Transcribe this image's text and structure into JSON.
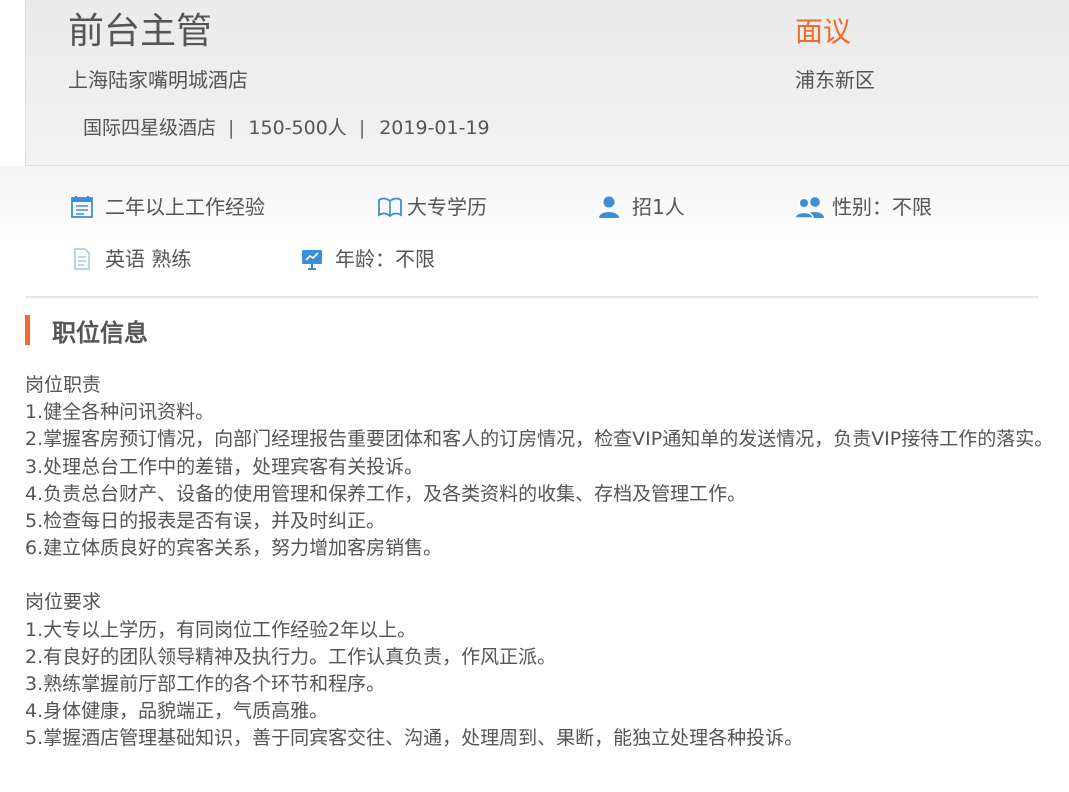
{
  "job": {
    "title": "前台主管",
    "salary": "面议",
    "company": "上海陆家嘴明城酒店",
    "district": "浦东新区",
    "meta": [
      "国际四星级酒店",
      "150-500人",
      "2019-01-19"
    ],
    "separator": "|"
  },
  "requirements": [
    {
      "icon": "calendar-icon",
      "label": "二年以上工作经验"
    },
    {
      "icon": "book-icon",
      "label": "大专学历"
    },
    {
      "icon": "person-icon",
      "label": "招1人"
    },
    {
      "icon": "people-icon",
      "label": "性别：不限"
    },
    {
      "icon": "document-icon",
      "label": "英语 熟练"
    },
    {
      "icon": "presentation-icon",
      "label": "年龄：不限"
    }
  ],
  "section": {
    "title": "职位信息"
  },
  "duties": {
    "heading": "岗位职责",
    "items": [
      "1.健全各种问讯资料。",
      "2.掌握客房预订情况，向部门经理报告重要团体和客人的订房情况，检查VIP通知单的发送情况，负责VIP接待工作的落实。",
      "3.处理总台工作中的差错，处理宾客有关投诉。",
      "4.负责总台财产、设备的使用管理和保养工作，及各类资料的收集、存档及管理工作。",
      "5.检查每日的报表是否有误，并及时纠正。",
      "6.建立体质良好的宾客关系，努力增加客房销售。"
    ]
  },
  "qualifications": {
    "heading": "岗位要求",
    "items": [
      "1.大专以上学历，有同岗位工作经验2年以上。",
      "2.有良好的团队领导精神及执行力。工作认真负责，作风正派。",
      "3.熟练掌握前厅部工作的各个环节和程序。",
      "4.身体健康，品貌端正，气质高雅。",
      "5.掌握酒店管理基础知识，善于同宾客交往、沟通，处理周到、果断，能独立处理各种投诉。"
    ]
  },
  "colors": {
    "accent": "#f26b2c",
    "icon": "#3a8fd8",
    "text": "#555555"
  }
}
